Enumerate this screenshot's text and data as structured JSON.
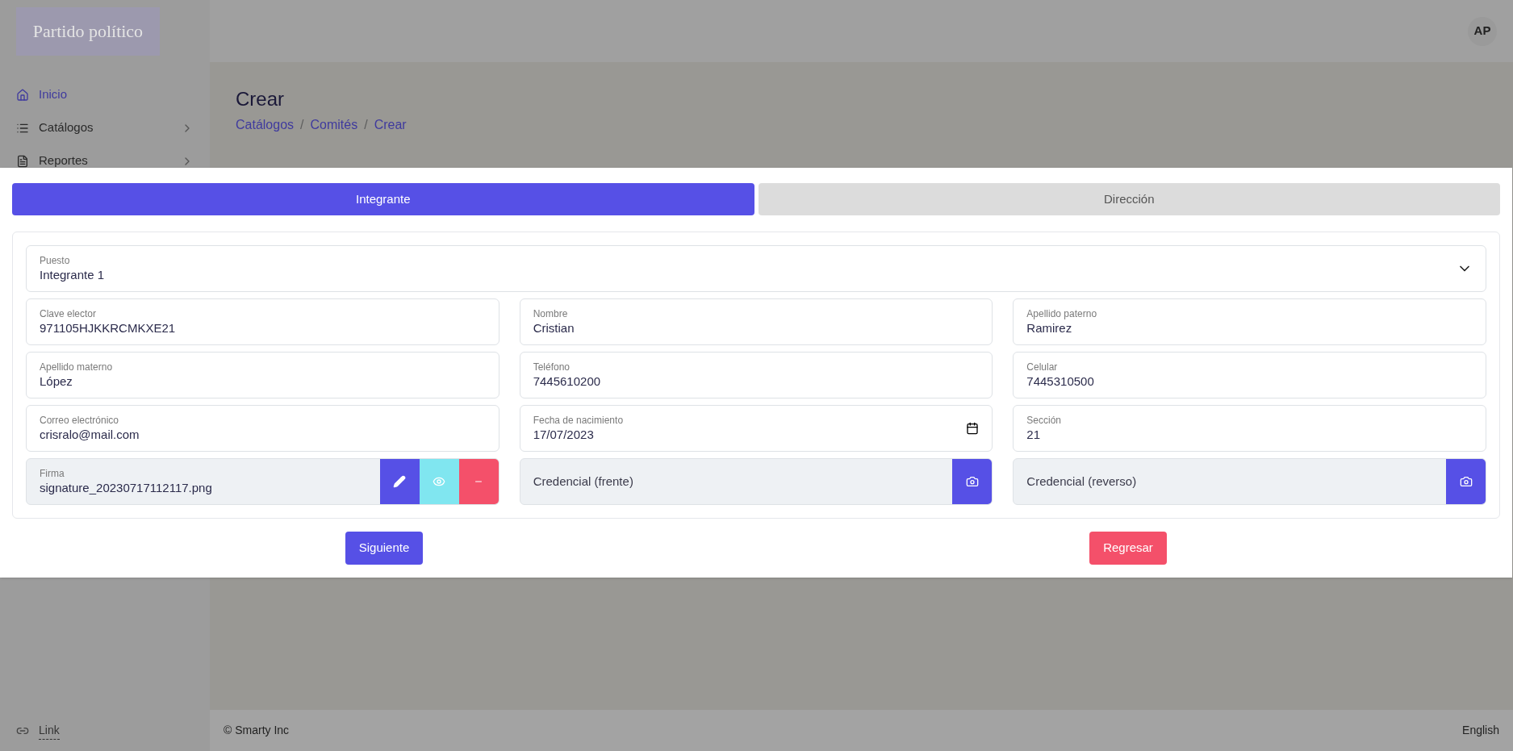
{
  "header": {
    "logo": "Partido político",
    "avatar": "AP"
  },
  "sidebar": {
    "items": [
      {
        "label": "Inicio",
        "selected": true,
        "expandable": false
      },
      {
        "label": "Catálogos",
        "selected": false,
        "expandable": true
      },
      {
        "label": "Reportes",
        "selected": false,
        "expandable": true
      }
    ],
    "footer_link": "Link"
  },
  "page": {
    "title": "Crear",
    "breadcrumbs": [
      "Catálogos",
      "Comités",
      "Crear"
    ],
    "breadcrumb_separator": "/"
  },
  "modal": {
    "tabs": [
      {
        "label": "Integrante",
        "selected": true
      },
      {
        "label": "Dirección",
        "selected": false
      }
    ],
    "puesto": {
      "label": "Puesto",
      "value": "Integrante 1"
    },
    "fields": [
      {
        "kind": "text",
        "label": "Clave elector",
        "value": "971105HJKKRCMKXE21"
      },
      {
        "kind": "text",
        "label": "Nombre",
        "value": "Cristian"
      },
      {
        "kind": "text",
        "label": "Apellido paterno",
        "value": "Ramirez"
      },
      {
        "kind": "text",
        "label": "Apellido materno",
        "value": "López"
      },
      {
        "kind": "text",
        "label": "Teléfono",
        "value": "7445610200"
      },
      {
        "kind": "text",
        "label": "Celular",
        "value": "7445310500"
      },
      {
        "kind": "text",
        "label": "Correo electrónico",
        "value": "crisralo@mail.com"
      },
      {
        "kind": "date",
        "label": "Fecha de nacimiento",
        "value": "17/07/2023"
      },
      {
        "kind": "text",
        "label": "Sección",
        "value": "21"
      },
      {
        "kind": "signature",
        "label": "Firma",
        "value": "signature_20230717112117.png"
      },
      {
        "kind": "photo",
        "placeholder": "Credencial (frente)"
      },
      {
        "kind": "photo",
        "placeholder": "Credencial (reverso)"
      }
    ],
    "buttons": [
      {
        "label": "Siguiente",
        "kind": "primary"
      },
      {
        "label": "Regresar",
        "kind": "danger"
      }
    ]
  },
  "footer": {
    "copyright": "© Smarty Inc",
    "language": "English"
  }
}
